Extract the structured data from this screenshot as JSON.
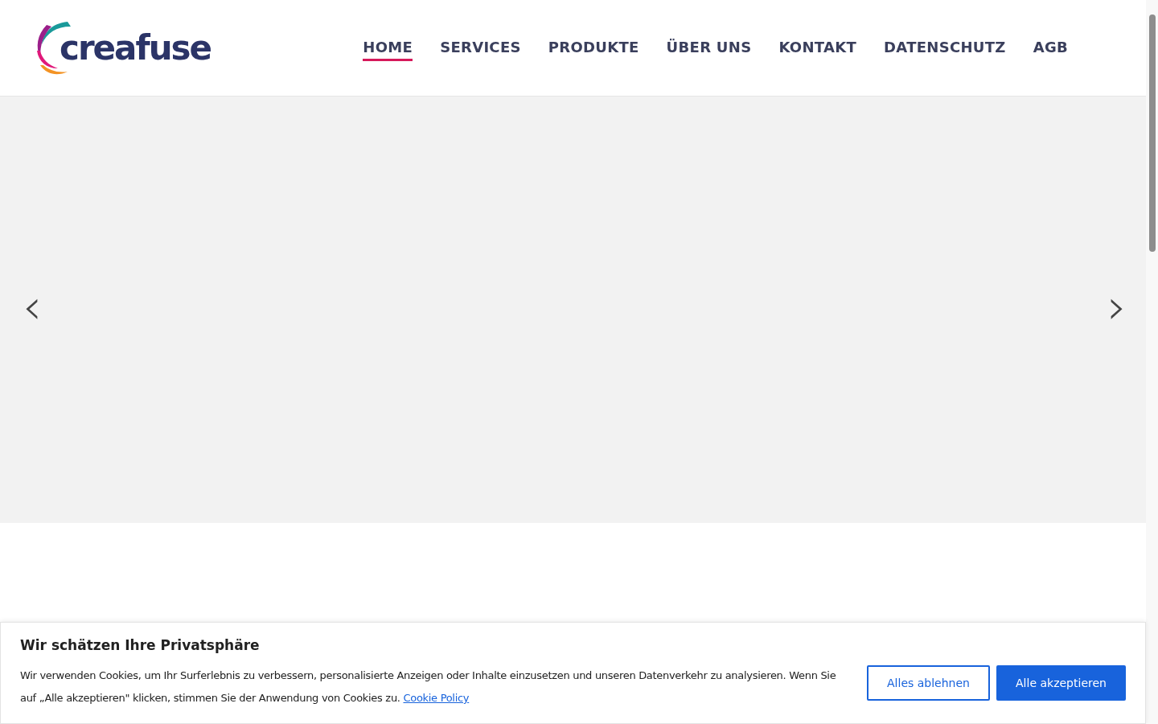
{
  "header": {
    "logo": "creafuse",
    "nav": [
      {
        "label": "HOME",
        "selected": true
      },
      {
        "label": "SERVICES",
        "selected": false
      },
      {
        "label": "PRODUKTE",
        "selected": false
      },
      {
        "label": "ÜBER UNS",
        "selected": false
      },
      {
        "label": "KONTAKT",
        "selected": false
      },
      {
        "label": "DATENSCHUTZ",
        "selected": false
      },
      {
        "label": "AGB",
        "selected": false
      }
    ]
  },
  "slider": {
    "prev": "‹",
    "next": "›"
  },
  "cookie_banner": {
    "title": "Wir schätzen Ihre Privatsphäre",
    "text": "Wir verwenden Cookies, um Ihr Surferlebnis zu verbessern, personalisierte Anzeigen oder Inhalte einzusetzen und unseren Datenverkehr zu analysieren. Wenn Sie auf „Alle akzeptieren\" klicken, stimmen Sie der Anwendung von Cookies zu.",
    "link": "Cookie Policy",
    "buttons": [
      {
        "label": "Alles ablehnen",
        "kind": "outline"
      },
      {
        "label": "Alle akzeptieren",
        "kind": "primary"
      }
    ]
  }
}
